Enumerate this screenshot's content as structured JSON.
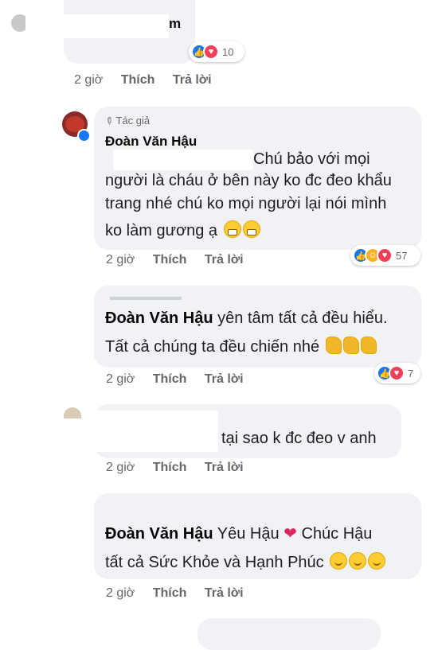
{
  "comment1": {
    "name_fragment": "m",
    "reaction_count": "10",
    "time": "2 giờ",
    "like": "Thích",
    "reply": "Trả lời"
  },
  "comment2": {
    "author_badge": "Tác giả",
    "author": "Đoàn Văn Hậu",
    "lines": [
      "Chú bảo với mọi",
      "người là cháu ở bên này ko đc đeo khẩu",
      "trang nhé chú ko mọi người lại nói mình",
      "ko làm gương ạ"
    ],
    "reaction_count": "57",
    "time": "2 giờ",
    "like": "Thích",
    "reply": "Trả lời"
  },
  "comment3": {
    "mention": "Đoàn Văn Hậu",
    "line1_rest": " yên tâm tất cả đều hiểu.",
    "line2": "Tất cả chúng ta đều chiến nhé ",
    "reaction_count": "7",
    "time": "2 giờ",
    "like": "Thích",
    "reply": "Trả lời"
  },
  "comment4": {
    "text": "tại sao k đc đeo v anh",
    "time": "2 giờ",
    "like": "Thích",
    "reply": "Trả lời"
  },
  "comment5": {
    "mention": "Đoàn Văn Hậu",
    "line1_rest": " Yêu Hậu ",
    "line1_tail": " Chúc Hậu",
    "line2": "tất cả Sức Khỏe và Hạnh Phúc ",
    "time": "2 giờ",
    "like": "Thích",
    "reply": "Trả lời"
  },
  "colors": {
    "bubble": "#f0f2f5",
    "action_text": "#65676b",
    "like_blue": "#1877f2",
    "love_red": "#f33e58"
  },
  "icons": [
    "pencil-icon",
    "verified-badge-icon",
    "like-reaction-icon",
    "love-reaction-icon",
    "haha-reaction-icon",
    "grimacing-emoji-icon",
    "flexed-biceps-emoji-icon",
    "red-heart-emoji-icon",
    "smiling-emoji-icon"
  ]
}
